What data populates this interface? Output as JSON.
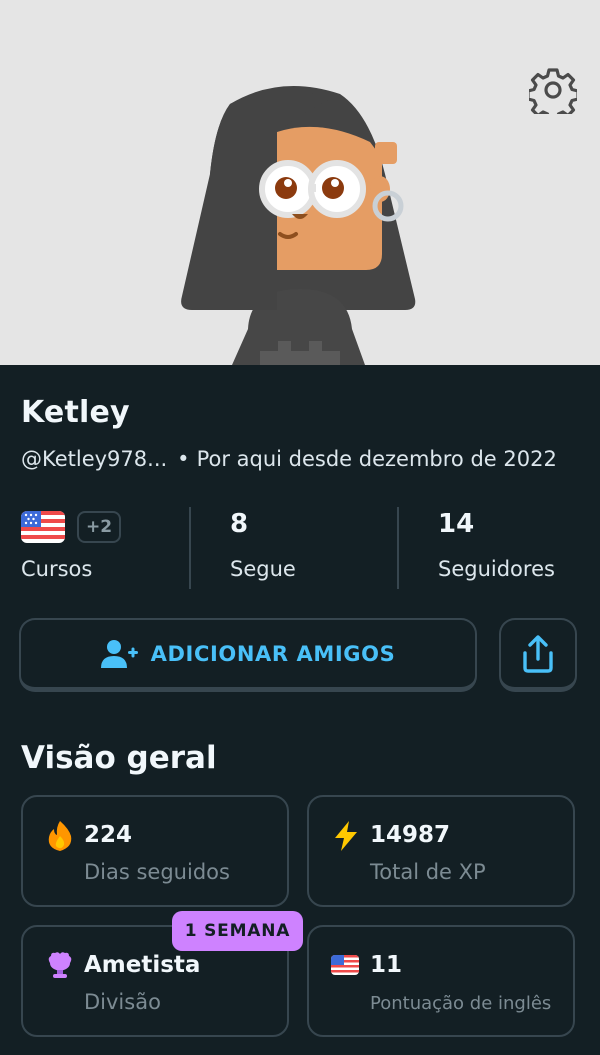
{
  "profile": {
    "name": "Ketley",
    "username": "@Ketley978...",
    "separator": "•",
    "joined": "Por aqui desde dezembro de 2022"
  },
  "stats": {
    "courses": {
      "extra": "+2",
      "label": "Cursos",
      "flag": "us-flag-icon"
    },
    "following": {
      "value": "8",
      "label": "Segue"
    },
    "followers": {
      "value": "14",
      "label": "Seguidores"
    }
  },
  "actions": {
    "add_friends": "ADICIONAR AMIGOS",
    "share_icon": "share-icon"
  },
  "overview": {
    "title": "Visão geral",
    "streak": {
      "value": "224",
      "label": "Dias seguidos",
      "icon": "flame-icon"
    },
    "xp": {
      "value": "14987",
      "label": "Total de XP",
      "icon": "lightning-icon"
    },
    "league": {
      "value": "Ametista",
      "label": "Divisão",
      "icon": "amethyst-trophy-icon",
      "badge": "1 SEMANA"
    },
    "score": {
      "value": "11",
      "label": "Pontuação de inglês",
      "icon": "us-flag-icon"
    }
  },
  "colors": {
    "background": "#131f24",
    "border": "#37464f",
    "accent_blue": "#49c0f8",
    "badge_purple": "#ce82ff",
    "hero_bg": "#e5e5e5"
  }
}
